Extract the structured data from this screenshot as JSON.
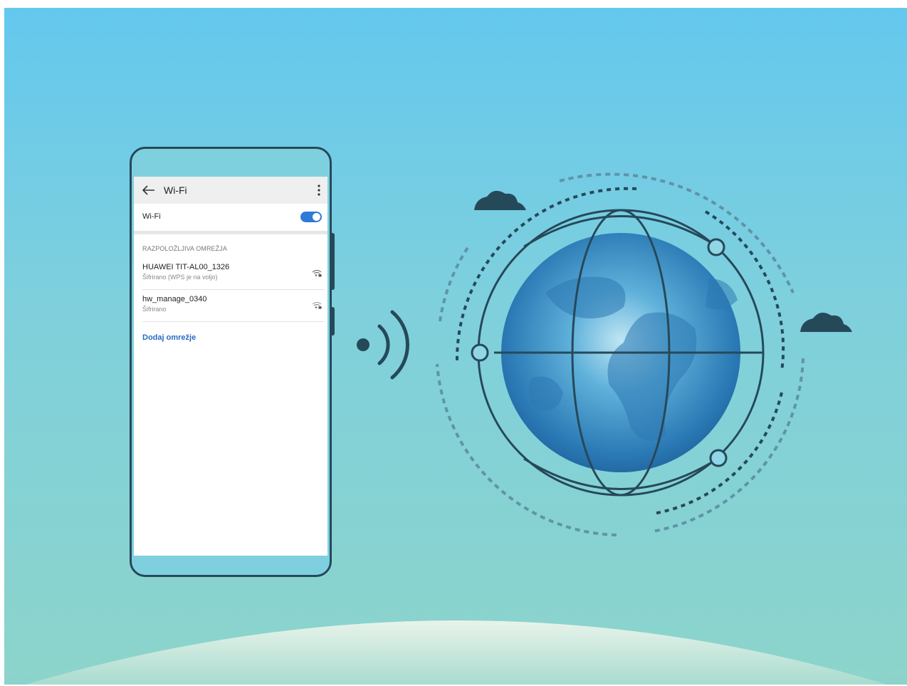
{
  "phone": {
    "header": {
      "title": "Wi-Fi"
    },
    "wifi_toggle": {
      "label": "Wi-Fi",
      "state": "on"
    },
    "section_title": "RAZPOLOŽLJIVA OMREŽJA",
    "networks": [
      {
        "name": "HUAWEI TIT-AL00_1326",
        "status": "Šifrirano (WPS je na voljo)"
      },
      {
        "name": "hw_manage_0340",
        "status": "Šifrirano"
      }
    ],
    "add_network_label": "Dodaj omrežje"
  },
  "colors": {
    "accent": "#2d7bd6",
    "outline": "#26495a",
    "link": "#2a6bc4"
  },
  "icons": [
    "back-arrow-icon",
    "more-vertical-icon",
    "wifi-lock-icon",
    "signal-waves-icon",
    "globe-icon",
    "cloud-icon"
  ]
}
